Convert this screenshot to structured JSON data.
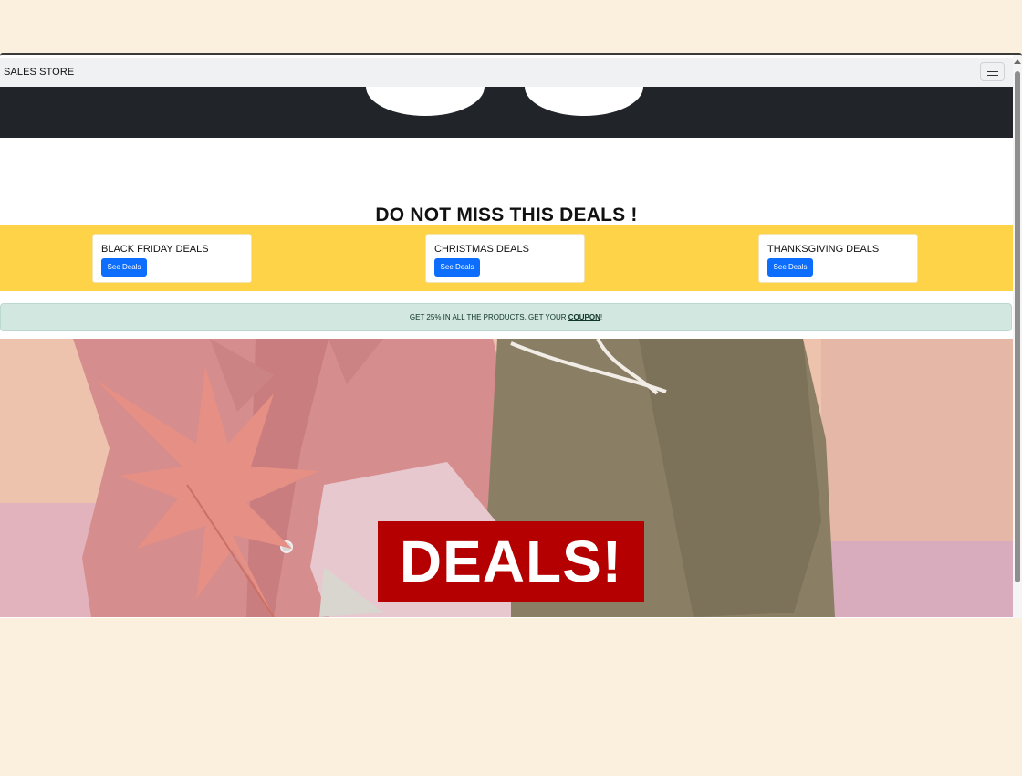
{
  "navbar": {
    "brand": "SALES STORE",
    "menu_icon": "hamburger-menu-icon"
  },
  "main": {
    "headline": "DO NOT MISS THIS DEALS !",
    "deal_cards": [
      {
        "title": "BLACK FRIDAY DEALS",
        "button": "See Deals"
      },
      {
        "title": "CHRISTMAS DEALS",
        "button": "See Deals"
      },
      {
        "title": "THANKSGIVING DEALS",
        "button": "See Deals"
      }
    ],
    "coupon": {
      "text": "GET 25% IN ALL THE PRODUCTS, GET YOUR ",
      "link": "COUPON",
      "suffix": "!"
    },
    "banner": {
      "badge": "DEALS!"
    }
  },
  "colors": {
    "background": "#faf0dd",
    "hero_dark": "#212529",
    "deals_band": "#ffd347",
    "button_primary": "#0d6efd",
    "coupon_bg": "#d1e7df",
    "badge_red": "#b40000"
  }
}
